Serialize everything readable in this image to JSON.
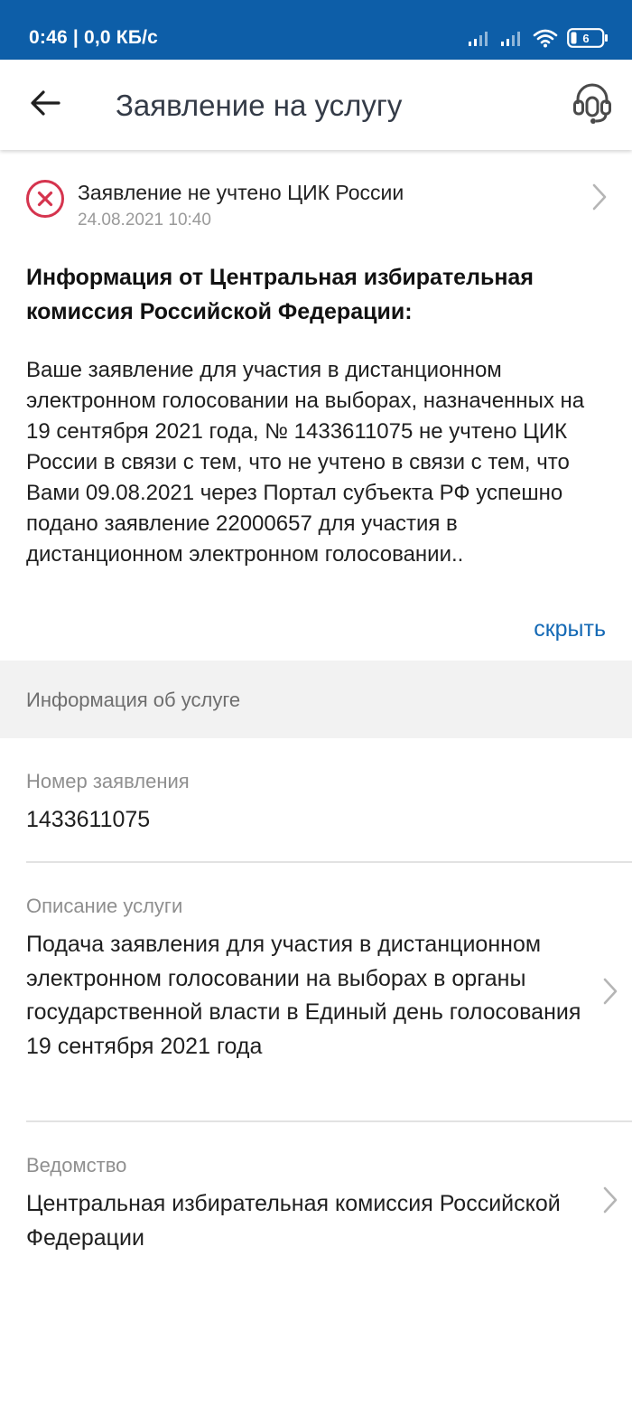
{
  "status_bar": {
    "time": "0:46 | 0,0 КБ/с",
    "battery": "6"
  },
  "app_bar": {
    "title": "Заявление на услугу",
    "back_icon": "arrow-left-icon",
    "support_icon": "headset-icon"
  },
  "notice": {
    "icon": "error-circle-icon",
    "title": "Заявление не учтено ЦИК России",
    "date": "24.08.2021 10:40"
  },
  "info": {
    "heading": "Информация от Центральная избирательная комиссия Российской Федерации:",
    "body": "Ваше заявление для участия в дистанционном электронном голосовании на выборах, назначенных на 19 сентября 2021 года, № 1433611075 не учтено ЦИК России в связи с тем, что не учтено в связи с тем, что Вами 09.08.2021 через Портал субъекта РФ успешно подано заявление 22000657 для участия в дистанционном электронном голосовании..",
    "hide_label": "скрыть"
  },
  "service_info": {
    "title": "Информация об услуге",
    "rows": [
      {
        "label": "Номер заявления",
        "value": "1433611075"
      },
      {
        "label": "Описание услуги",
        "value": "Подача заявления для участия в дистанционном электронном голосовании на выборах в органы государственной власти в Единый день голосования 19 сентября 2021 года"
      },
      {
        "label": "Ведомство",
        "value": "Центральная избирательная комиссия Российской Федерации"
      }
    ]
  },
  "colors": {
    "status_bar": "#0d5ea8",
    "link": "#1469b5",
    "error": "#d5344e",
    "section_band": "#f2f2f2"
  }
}
